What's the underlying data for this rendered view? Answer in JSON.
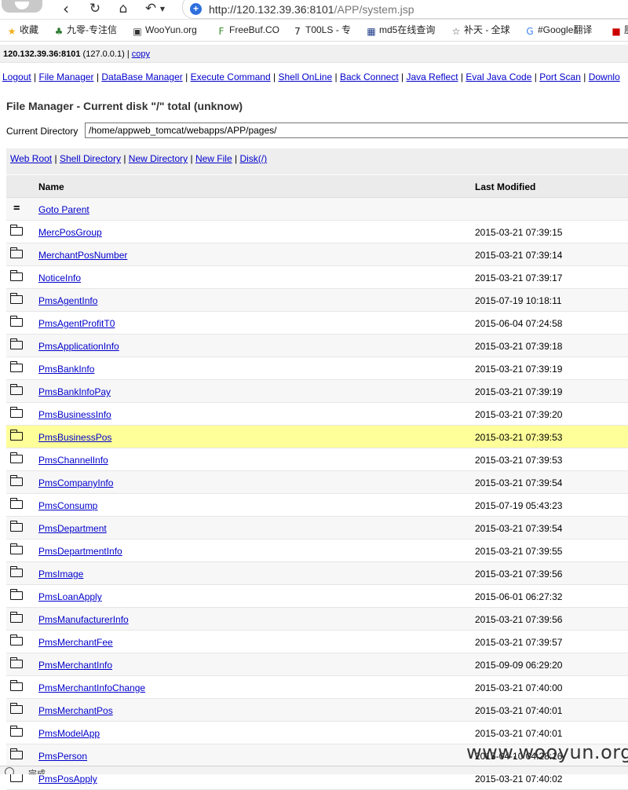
{
  "browser": {
    "url_host": "http://120.132.39.36:8101",
    "url_path": "/APP/system.jsp",
    "bookmarks": [
      {
        "label": "收藏",
        "icon": "star-icon",
        "color": "#f2b01e"
      },
      {
        "label": "九零-专注信",
        "icon": "turtle-icon",
        "color": "#2f7d32"
      },
      {
        "label": "WooYun.org",
        "icon": "wooyun-icon",
        "color": "#333333"
      },
      {
        "label": "FreeBuf.CO",
        "icon": "freebuf-icon",
        "color": "#3a8f2a"
      },
      {
        "label": "T00LS - 专",
        "icon": "tools-icon",
        "color": "#222222"
      },
      {
        "label": "md5在线查询",
        "icon": "grid-icon",
        "color": "#1f3d8a"
      },
      {
        "label": "补天 - 全球",
        "icon": "butian-icon",
        "color": "#444444"
      },
      {
        "label": "#Google翻译",
        "icon": "translate-icon",
        "color": "#4285f4"
      },
      {
        "label": "厨",
        "icon": "cook-icon",
        "color": "#cc0000"
      }
    ]
  },
  "page": {
    "host_bold": "120.132.39.36:8101",
    "host_ip": "(127.0.0.1)",
    "host_sep": "|",
    "copy_label": "copy",
    "menu": [
      "Logout",
      "File Manager",
      "DataBase Manager",
      "Execute Command",
      "Shell OnLine",
      "Back Connect",
      "Java Reflect",
      "Eval Java Code",
      "Port Scan",
      "Downlo"
    ],
    "menu_sep": "|",
    "title": "File Manager - Current disk \"/\" total (unknow)",
    "current_dir_label": "Current Directory",
    "current_dir_value": "/home/appweb_tomcat/webapps/APP/pages/",
    "shortcuts": [
      "Web Root",
      "Shell Directory",
      "New Directory",
      "New File",
      "Disk(/)"
    ],
    "columns": {
      "name": "Name",
      "modified": "Last Modified"
    },
    "parent_label": "Goto Parent",
    "parent_icon": "=",
    "highlight_row": "PmsBusinessPos",
    "rows": [
      {
        "name": "MercPosGroup",
        "modified": "2015-03-21 07:39:15"
      },
      {
        "name": "MerchantPosNumber",
        "modified": "2015-03-21 07:39:14"
      },
      {
        "name": "NoticeInfo",
        "modified": "2015-03-21 07:39:17"
      },
      {
        "name": "PmsAgentInfo",
        "modified": "2015-07-19 10:18:11"
      },
      {
        "name": "PmsAgentProfitT0",
        "modified": "2015-06-04 07:24:58"
      },
      {
        "name": "PmsApplicationInfo",
        "modified": "2015-03-21 07:39:18"
      },
      {
        "name": "PmsBankInfo",
        "modified": "2015-03-21 07:39:19"
      },
      {
        "name": "PmsBankInfoPay",
        "modified": "2015-03-21 07:39:19"
      },
      {
        "name": "PmsBusinessInfo",
        "modified": "2015-03-21 07:39:20"
      },
      {
        "name": "PmsBusinessPos",
        "modified": "2015-03-21 07:39:53"
      },
      {
        "name": "PmsChannelInfo",
        "modified": "2015-03-21 07:39:53"
      },
      {
        "name": "PmsCompanyInfo",
        "modified": "2015-03-21 07:39:54"
      },
      {
        "name": "PmsConsump",
        "modified": "2015-07-19 05:43:23"
      },
      {
        "name": "PmsDepartment",
        "modified": "2015-03-21 07:39:54"
      },
      {
        "name": "PmsDepartmentInfo",
        "modified": "2015-03-21 07:39:55"
      },
      {
        "name": "PmsImage",
        "modified": "2015-03-21 07:39:56"
      },
      {
        "name": "PmsLoanApply",
        "modified": "2015-06-01 06:27:32"
      },
      {
        "name": "PmsManufacturerInfo",
        "modified": "2015-03-21 07:39:56"
      },
      {
        "name": "PmsMerchantFee",
        "modified": "2015-03-21 07:39:57"
      },
      {
        "name": "PmsMerchantInfo",
        "modified": "2015-09-09 06:29:20"
      },
      {
        "name": "PmsMerchantInfoChange",
        "modified": "2015-03-21 07:40:00"
      },
      {
        "name": "PmsMerchantPos",
        "modified": "2015-03-21 07:40:01"
      },
      {
        "name": "PmsModelApp",
        "modified": "2015-03-21 07:40:01"
      },
      {
        "name": "PmsPerson",
        "modified": "2015-04-10 04:28:16"
      },
      {
        "name": "PmsPosApply",
        "modified": "2015-03-21 07:40:02"
      }
    ]
  },
  "watermark": "www.wooyun.org",
  "status": {
    "text": "完成"
  }
}
